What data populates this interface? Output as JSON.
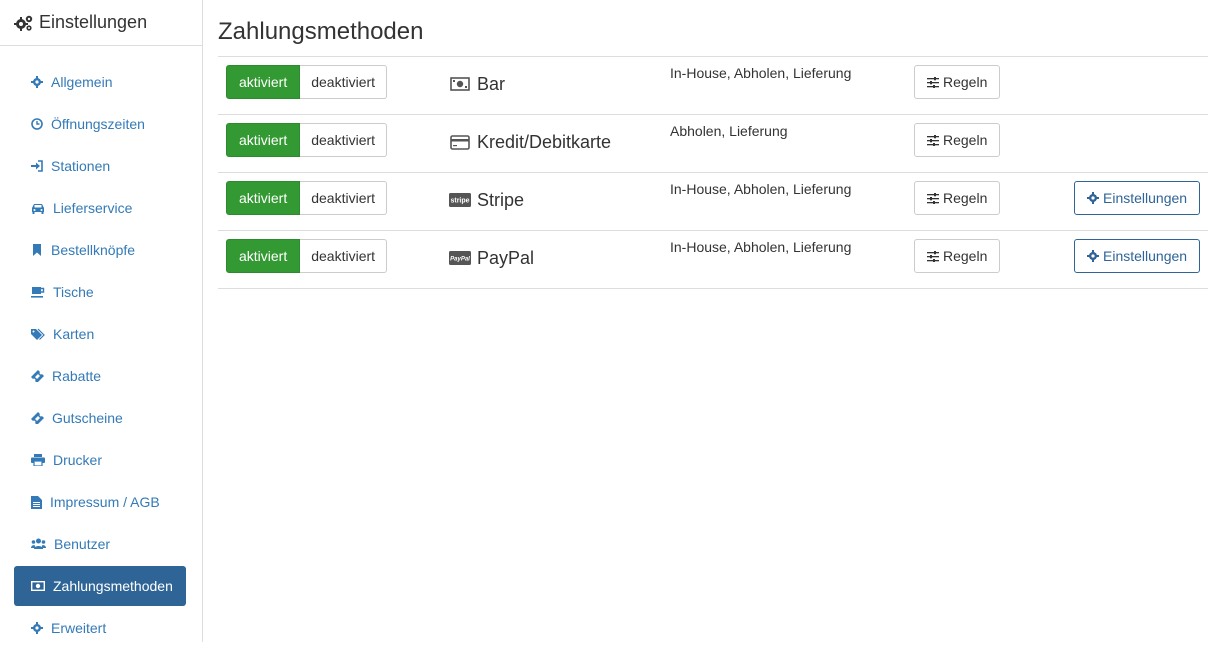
{
  "sidebar": {
    "title": "Einstellungen",
    "items": [
      {
        "label": "Allgemein",
        "icon": "gear-icon"
      },
      {
        "label": "Öffnungszeiten",
        "icon": "clock-icon"
      },
      {
        "label": "Stationen",
        "icon": "sign-in-icon"
      },
      {
        "label": "Lieferservice",
        "icon": "car-icon"
      },
      {
        "label": "Bestellknöpfe",
        "icon": "bookmark-icon"
      },
      {
        "label": "Tische",
        "icon": "coffee-icon"
      },
      {
        "label": "Karten",
        "icon": "tags-icon"
      },
      {
        "label": "Rabatte",
        "icon": "ticket-icon"
      },
      {
        "label": "Gutscheine",
        "icon": "ticket-icon"
      },
      {
        "label": "Drucker",
        "icon": "print-icon"
      },
      {
        "label": "Impressum / AGB",
        "icon": "file-text-icon"
      },
      {
        "label": "Benutzer",
        "icon": "users-icon"
      },
      {
        "label": "Zahlungsmethoden",
        "icon": "money-icon",
        "active": true
      },
      {
        "label": "Erweitert",
        "icon": "gear-icon"
      }
    ]
  },
  "main": {
    "title": "Zahlungsmethoden",
    "methods": [
      {
        "name": "Bar",
        "icon": "money-icon",
        "modes": "In-House, Abholen, Lieferung",
        "on_label": "aktiviert",
        "off_label": "deaktiviert",
        "rules_label": "Regeln"
      },
      {
        "name": "Kredit/Debitkarte",
        "icon": "credit-card-icon",
        "modes": "Abholen, Lieferung",
        "on_label": "aktiviert",
        "off_label": "deaktiviert",
        "rules_label": "Regeln"
      },
      {
        "name": "Stripe",
        "icon": "stripe-logo-icon",
        "logo_text": "stripe",
        "modes": "In-House, Abholen, Lieferung",
        "on_label": "aktiviert",
        "off_label": "deaktiviert",
        "rules_label": "Regeln",
        "settings_label": "Einstellungen"
      },
      {
        "name": "PayPal",
        "icon": "paypal-logo-icon",
        "logo_text": "PayPal",
        "modes": "In-House, Abholen, Lieferung",
        "on_label": "aktiviert",
        "off_label": "deaktiviert",
        "rules_label": "Regeln",
        "settings_label": "Einstellungen"
      }
    ]
  },
  "colors": {
    "active_green": "#339933",
    "link_blue": "#337ab7",
    "active_nav": "#2f6497"
  }
}
